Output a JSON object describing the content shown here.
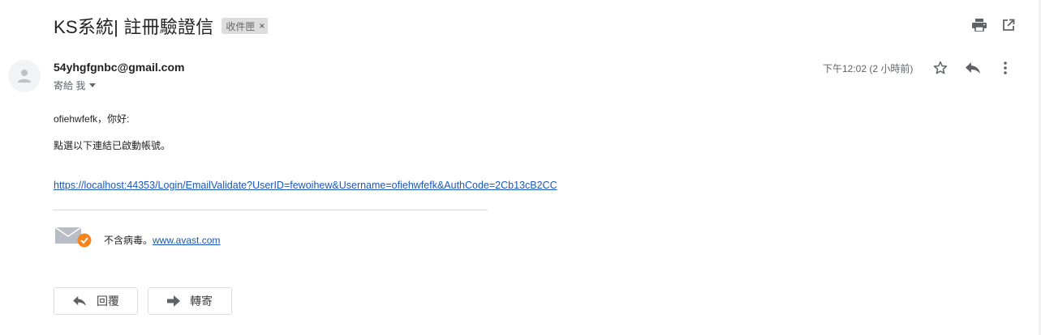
{
  "email": {
    "subject": "KS系統| 註冊驗證信",
    "label": "收件匣",
    "label_close": "×",
    "sender": "54yhgfgnbc@gmail.com",
    "to_me": "寄給 我",
    "date": "下午12:02 (2 小時前)",
    "greeting": "ofiehwfefk，你好:",
    "instruction": "點選以下連結已啟動帳號。",
    "link": "https://localhost:44353/Login/EmailValidate?UserID=fewoihew&Username=ofiehwfefk&AuthCode=2Cb13cB2CC"
  },
  "avast": {
    "text": "不含病毒。",
    "link": "www.avast.com"
  },
  "actions": {
    "reply_label": "回覆",
    "forward_label": "轉寄"
  },
  "icons": {
    "print": "print-icon",
    "open_new_window": "open-in-new-window-icon",
    "star": "star-icon",
    "reply": "reply-icon",
    "more": "more-vertical-icon"
  }
}
